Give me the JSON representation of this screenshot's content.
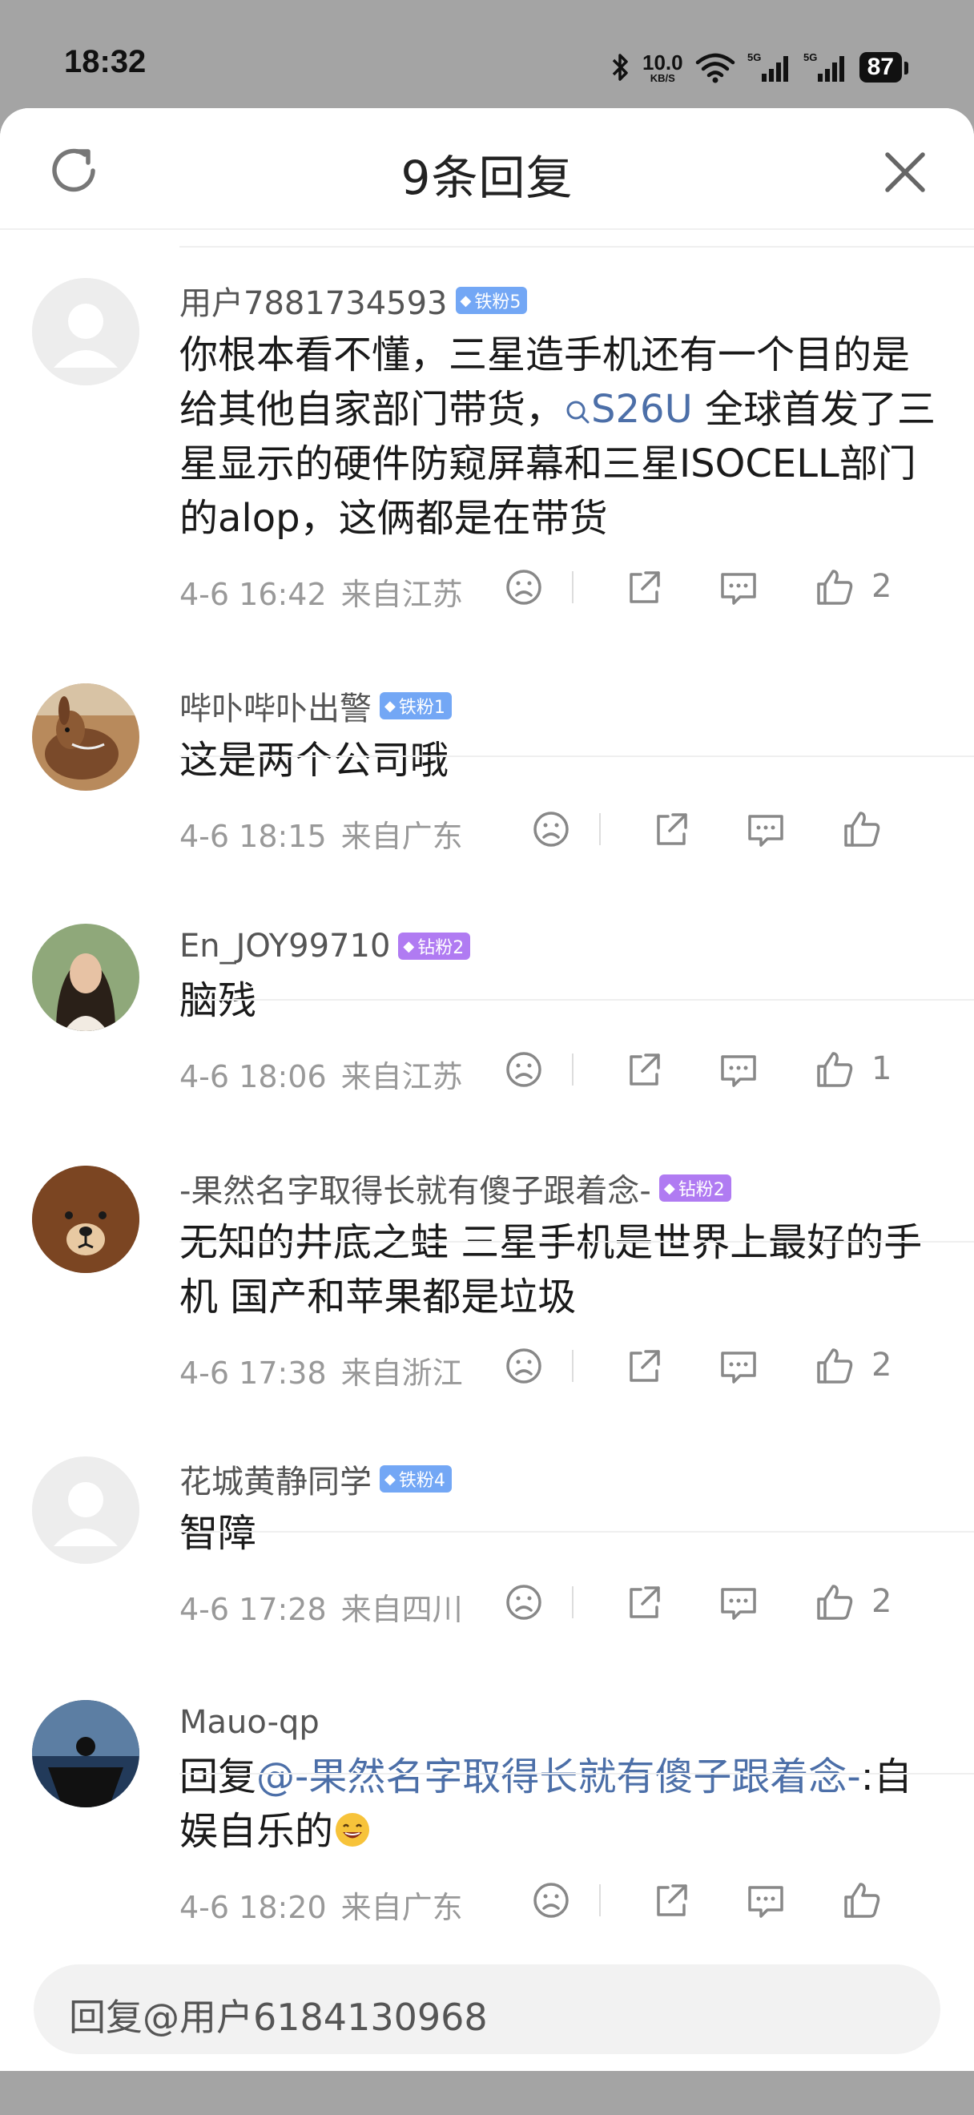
{
  "status_bar": {
    "time": "18:32",
    "net_speed_value": "10.0",
    "net_speed_unit": "KB/S",
    "signal_1": "5G",
    "signal_2": "5G",
    "battery": "87"
  },
  "sheet": {
    "title": "9条回复",
    "refresh_icon": "refresh-icon",
    "close_icon": "close-icon"
  },
  "comments": [
    {
      "username": "用户7881734593",
      "badge": "铁粉5",
      "badge_type": "iron",
      "text_before_link": "你根本看不懂，三星造手机还有一个目的是给其他自家部门带货，",
      "link_text": "S26U",
      "text_after_link": " 全球首发了三星显示的硬件防窥屏幕和三星ISOCELL部门的alop，这俩都是在带货",
      "time": "4-6 16:42",
      "location": "来自江苏",
      "likes": "2"
    },
    {
      "username": "哔卟哔卟出警",
      "badge": "铁粉1",
      "badge_type": "iron",
      "text": "这是两个公司哦",
      "time": "4-6 18:15",
      "location": "来自广东",
      "likes": ""
    },
    {
      "username": "En_JOY99710",
      "badge": "钻粉2",
      "badge_type": "diamond",
      "text": "脑残",
      "time": "4-6 18:06",
      "location": "来自江苏",
      "likes": "1"
    },
    {
      "username": "-果然名字取得长就有傻子跟着念-",
      "badge": "钻粉2",
      "badge_type": "diamond",
      "text": "无知的井底之蛙  三星手机是世界上最好的手机 国产和苹果都是垃圾",
      "time": "4-6 17:38",
      "location": "来自浙江",
      "likes": "2"
    },
    {
      "username": "花城黄静同学",
      "badge": "铁粉4",
      "badge_type": "iron",
      "text": "智障",
      "time": "4-6 17:28",
      "location": "来自四川",
      "likes": "2"
    },
    {
      "username": "Mauo-qp",
      "badge": "",
      "reply_prefix": "回复",
      "mention": "@-果然名字取得长就有傻子跟着念-",
      "reply_text": ":自娱自乐的",
      "time": "4-6 18:20",
      "location": "来自广东",
      "likes": ""
    }
  ],
  "reply_input": {
    "placeholder": "回复@用户6184130968"
  },
  "colors": {
    "link": "#4c6fa8",
    "iron_badge": "#73a7f5",
    "diamond_badge": "#b07bf2",
    "status_bg": "#a4a4a4"
  }
}
